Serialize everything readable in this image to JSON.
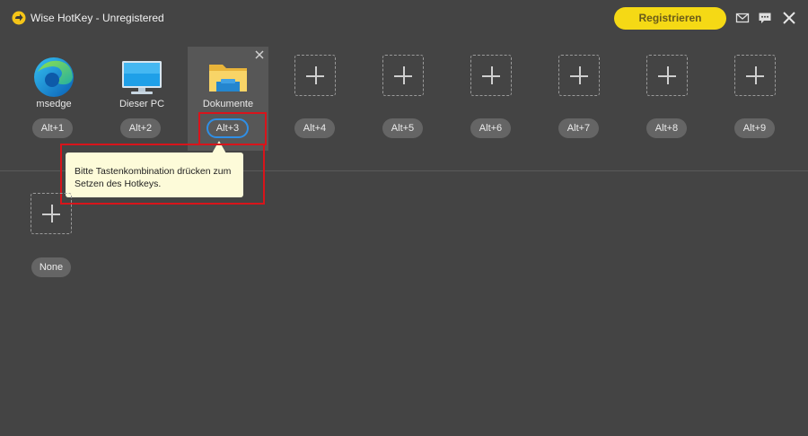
{
  "window": {
    "title": "Wise HotKey - Unregistered",
    "register_label": "Registrieren"
  },
  "slots": [
    {
      "label": "msedge",
      "hotkey": "Alt+1",
      "icon": "msedge-icon"
    },
    {
      "label": "Dieser PC",
      "hotkey": "Alt+2",
      "icon": "monitor-icon"
    },
    {
      "label": "Dokumente",
      "hotkey": "Alt+3",
      "icon": "folder-icon"
    },
    {
      "label": "",
      "hotkey": "Alt+4",
      "icon": "plus-icon"
    },
    {
      "label": "",
      "hotkey": "Alt+5",
      "icon": "plus-icon"
    },
    {
      "label": "",
      "hotkey": "Alt+6",
      "icon": "plus-icon"
    },
    {
      "label": "",
      "hotkey": "Alt+7",
      "icon": "plus-icon"
    },
    {
      "label": "",
      "hotkey": "Alt+8",
      "icon": "plus-icon"
    },
    {
      "label": "",
      "hotkey": "Alt+9",
      "icon": "plus-icon"
    }
  ],
  "tooltip": {
    "line1": "Bitte Tastenkombination drücken zum",
    "line2": "Setzen des Hotkeys."
  },
  "second_row": {
    "hotkey": "None"
  },
  "colors": {
    "background": "#444444",
    "register_button": "#f5d915",
    "highlight": "#d8141b",
    "active_hotkey_border": "#2f8fe6",
    "tooltip_bg": "#fdfbd9"
  }
}
